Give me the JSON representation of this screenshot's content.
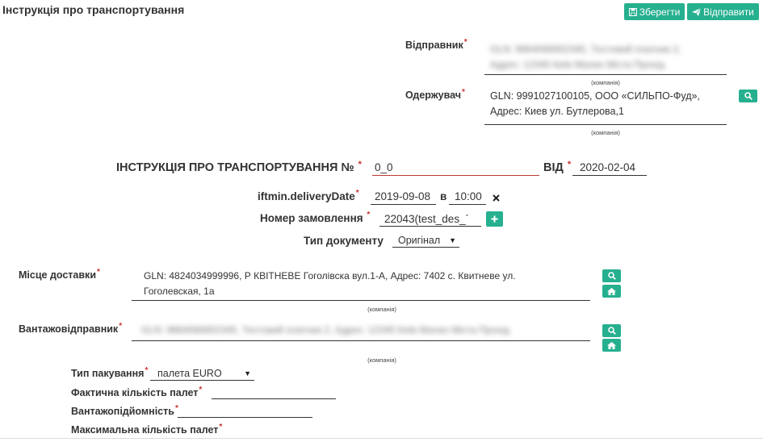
{
  "header": {
    "title": "Інструкція про транспортування",
    "save_label": "Зберегти",
    "send_label": "Відправити"
  },
  "sender": {
    "label": "Відправник",
    "value_line1": "GLN: 9864066902345, Тестовий платник 2,",
    "value_line2": "Адрес: 12345 Київ Малих Міста Прохід",
    "caption": "(компанія)"
  },
  "receiver": {
    "label": "Одержувач",
    "value_line1": "GLN: 9991027100105, ООО «СИЛЬПО-Фуд»,",
    "value_line2": "Адрес: Киев ул. Бутлерова,1",
    "caption": "(компанія)"
  },
  "instruction": {
    "label": "ІНСТРУКЦІЯ ПРО ТРАНСПОРТУВАННЯ №",
    "number": "0_0",
    "from_label": "ВІД",
    "date": "2020-02-04"
  },
  "delivery": {
    "label": "iftmin.deliveryDate",
    "date": "2019-09-08",
    "in_label": "в",
    "time": "10:00"
  },
  "order": {
    "label": "Номер замовлення",
    "value": "22043(test_des_´"
  },
  "doc_type": {
    "label": "Тип документу",
    "value": "Оригінал"
  },
  "delivery_place": {
    "label": "Місце доставки",
    "value_line1": "GLN: 4824034999996, Р КВІТНЕВЕ Гоголівска вул.1-А, Адрес: 7402 с. Квитневе ул.",
    "value_line2": "Гоголевская, 1а",
    "caption": "(компанія)"
  },
  "shipper": {
    "label": "Вантажовідправник",
    "value": "GLN: 9864066902345, Тестовий платник 2, Адрес: 12345 Київ Малих Міста Прохід",
    "caption": "(компанія)"
  },
  "packaging": {
    "label": "Тип пакування",
    "value": "палета EURO"
  },
  "actual_pallets": {
    "label": "Фактична кількість палет"
  },
  "capacity": {
    "label": "Вантажопідйомність"
  },
  "max_pallets": {
    "label": "Максимальна кількість палет"
  },
  "required_mark": "*",
  "colors": {
    "accent": "#26b08f",
    "required": "#c9302c",
    "number_underline": "#c0392b"
  }
}
